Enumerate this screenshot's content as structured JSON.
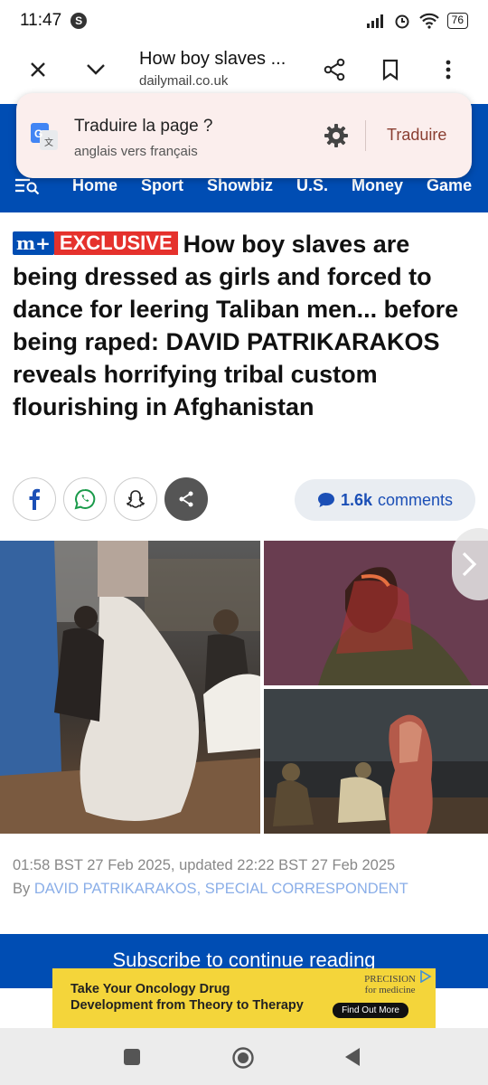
{
  "status": {
    "time": "11:47",
    "app_badge": "S",
    "battery": "76"
  },
  "browser": {
    "title": "How boy slaves ...",
    "url": "dailymail.co.uk"
  },
  "translate": {
    "title": "Traduire la page ?",
    "subtitle": "anglais vers français",
    "button": "Traduire"
  },
  "nav": {
    "items": [
      "Home",
      "Sport",
      "Showbiz",
      "U.S.",
      "Money",
      "Game"
    ]
  },
  "article": {
    "badge_mplus": "m+",
    "badge_exclusive": "EXCLUSIVE",
    "headline": "How boy slaves are being dressed as girls and forced to dance for leering Taliban men... before being raped: DAVID PATRIKARAKOS reveals horrifying tribal custom flourishing in Afghanistan",
    "comments_count": "1.6k",
    "comments_label": "comments",
    "timestamp": "01:58 BST 27 Feb 2025, updated 22:22 BST 27 Feb 2025",
    "by_prefix": "By",
    "author": "DAVID PATRIKARAKOS, SPECIAL CORRESPONDENT"
  },
  "subscribe": {
    "text": "Subscribe to continue reading"
  },
  "ad": {
    "text_line1": "Take Your Oncology Drug",
    "text_line2": "Development from Theory to Therapy",
    "brand": "PRECISION",
    "brand_sub": "for medicine",
    "cta": "Find Out More"
  },
  "colors": {
    "brand_blue": "#004db3",
    "exclusive_red": "#e5312c",
    "popup_bg": "#fbeeed",
    "ad_yellow": "#f4d53a"
  }
}
